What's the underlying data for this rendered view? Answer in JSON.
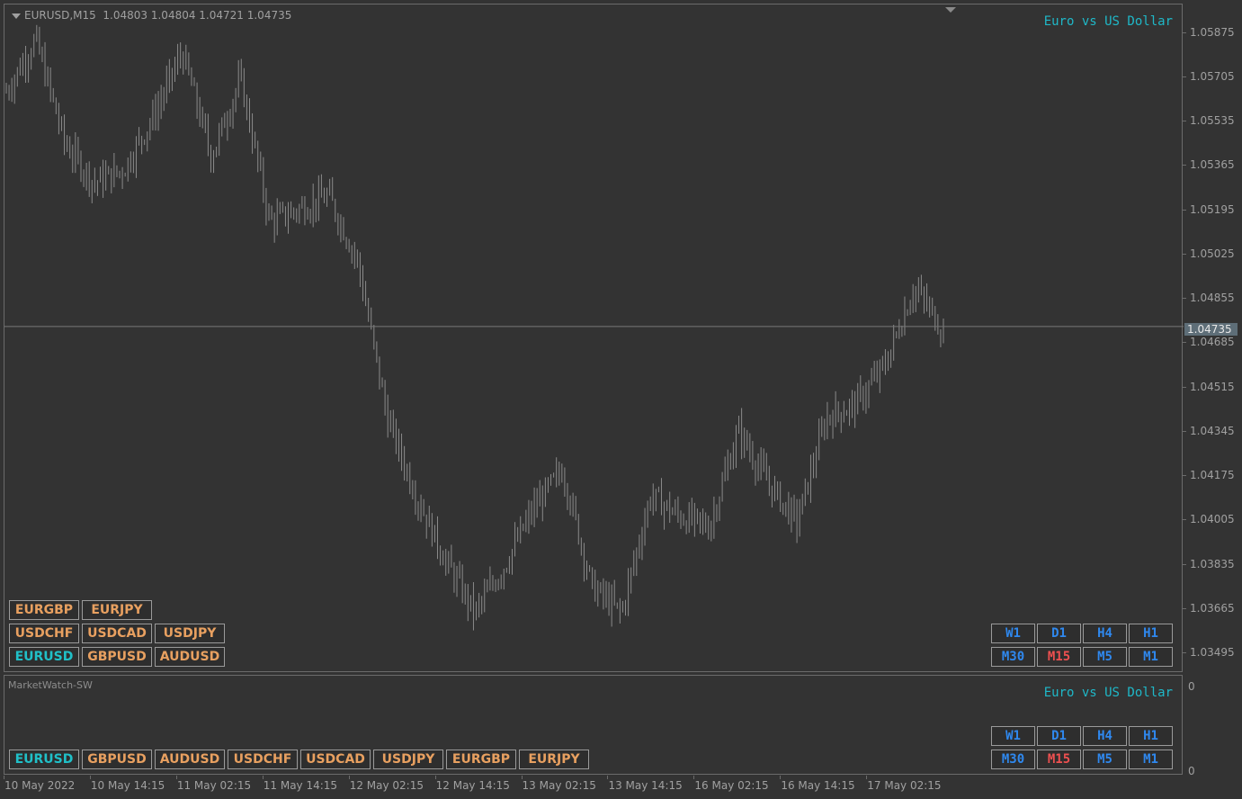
{
  "chart": {
    "header_symbol": "EURUSD,M15",
    "ohlc": "1.04803 1.04804 1.04721 1.04735",
    "description": "Euro vs US Dollar",
    "current_price": "1.04735",
    "current_price_value": 1.04735,
    "price_min": 1.0342,
    "price_max": 1.0597
  },
  "main_symbols": [
    [
      "EURGBP",
      "EURJPY"
    ],
    [
      "USDCHF",
      "USDCAD",
      "USDJPY"
    ],
    [
      "EURUSD",
      "GBPUSD",
      "AUDUSD"
    ]
  ],
  "active_symbol": "EURUSD",
  "timeframes": [
    [
      "W1",
      "D1",
      "H4",
      "H1"
    ],
    [
      "M30",
      "M15",
      "M5",
      "M1"
    ]
  ],
  "active_timeframe": "M15",
  "subwindow": {
    "title": "MarketWatch-SW",
    "description": "Euro vs US Dollar",
    "symbols": [
      "EURUSD",
      "GBPUSD",
      "AUDUSD",
      "USDCHF",
      "USDCAD",
      "USDJPY",
      "EURGBP",
      "EURJPY"
    ],
    "axis_top": "0",
    "axis_bottom": "0"
  },
  "price_axis": [
    "1.05875",
    "1.05705",
    "1.05535",
    "1.05365",
    "1.05195",
    "1.05025",
    "1.04855",
    "1.04685",
    "1.04515",
    "1.04345",
    "1.04175",
    "1.04005",
    "1.03835",
    "1.03665",
    "1.03495"
  ],
  "time_axis": [
    "10 May 2022",
    "10 May 14:15",
    "11 May 02:15",
    "11 May 14:15",
    "12 May 02:15",
    "12 May 14:15",
    "13 May 02:15",
    "13 May 14:15",
    "16 May 02:15",
    "16 May 14:15",
    "17 May 02:15"
  ],
  "colors": {
    "background": "#333333",
    "bars": "#8a8a8a",
    "symbol_text": "#e8a060",
    "active_symbol_text": "#20c0c8",
    "timeframe_text": "#2f88ee",
    "active_timeframe_text": "#ee5050",
    "description_text": "#1fb8c8"
  },
  "chart_data": {
    "type": "ohlc",
    "symbol": "EURUSD",
    "timeframe": "M15",
    "close_path": [
      {
        "x": "10 May 2022",
        "y": 1.0565
      },
      {
        "x": "10 May 06:00",
        "y": 1.0585
      },
      {
        "x": "10 May 14:15",
        "y": 1.0545
      },
      {
        "x": "10 May 19:00",
        "y": 1.053
      },
      {
        "x": "11 May 02:15",
        "y": 1.0535
      },
      {
        "x": "11 May 06:00",
        "y": 1.0555
      },
      {
        "x": "11 May 09:30",
        "y": 1.058
      },
      {
        "x": "11 May 12:00",
        "y": 1.054
      },
      {
        "x": "11 May 14:15",
        "y": 1.057
      },
      {
        "x": "11 May 20:00",
        "y": 1.0515
      },
      {
        "x": "12 May 00:30",
        "y": 1.052
      },
      {
        "x": "12 May 02:15",
        "y": 1.0525
      },
      {
        "x": "12 May 06:00",
        "y": 1.05
      },
      {
        "x": "12 May 10:00",
        "y": 1.044
      },
      {
        "x": "12 May 14:15",
        "y": 1.041
      },
      {
        "x": "12 May 17:00",
        "y": 1.0385
      },
      {
        "x": "12 May 22:00",
        "y": 1.0365
      },
      {
        "x": "13 May 02:15",
        "y": 1.0383
      },
      {
        "x": "13 May 08:00",
        "y": 1.0405
      },
      {
        "x": "13 May 10:30",
        "y": 1.042
      },
      {
        "x": "13 May 14:15",
        "y": 1.0375
      },
      {
        "x": "13 May 17:00",
        "y": 1.0365
      },
      {
        "x": "13 May 22:00",
        "y": 1.041
      },
      {
        "x": "16 May 02:15",
        "y": 1.0402
      },
      {
        "x": "16 May 06:00",
        "y": 1.0398
      },
      {
        "x": "16 May 09:00",
        "y": 1.0435
      },
      {
        "x": "16 May 14:15",
        "y": 1.0415
      },
      {
        "x": "16 May 18:00",
        "y": 1.04
      },
      {
        "x": "16 May 22:00",
        "y": 1.044
      },
      {
        "x": "17 May 02:15",
        "y": 1.0445
      },
      {
        "x": "17 May 06:00",
        "y": 1.046
      },
      {
        "x": "17 May 09:30",
        "y": 1.049
      },
      {
        "x": "17 May 11:00",
        "y": 1.04735
      }
    ]
  }
}
